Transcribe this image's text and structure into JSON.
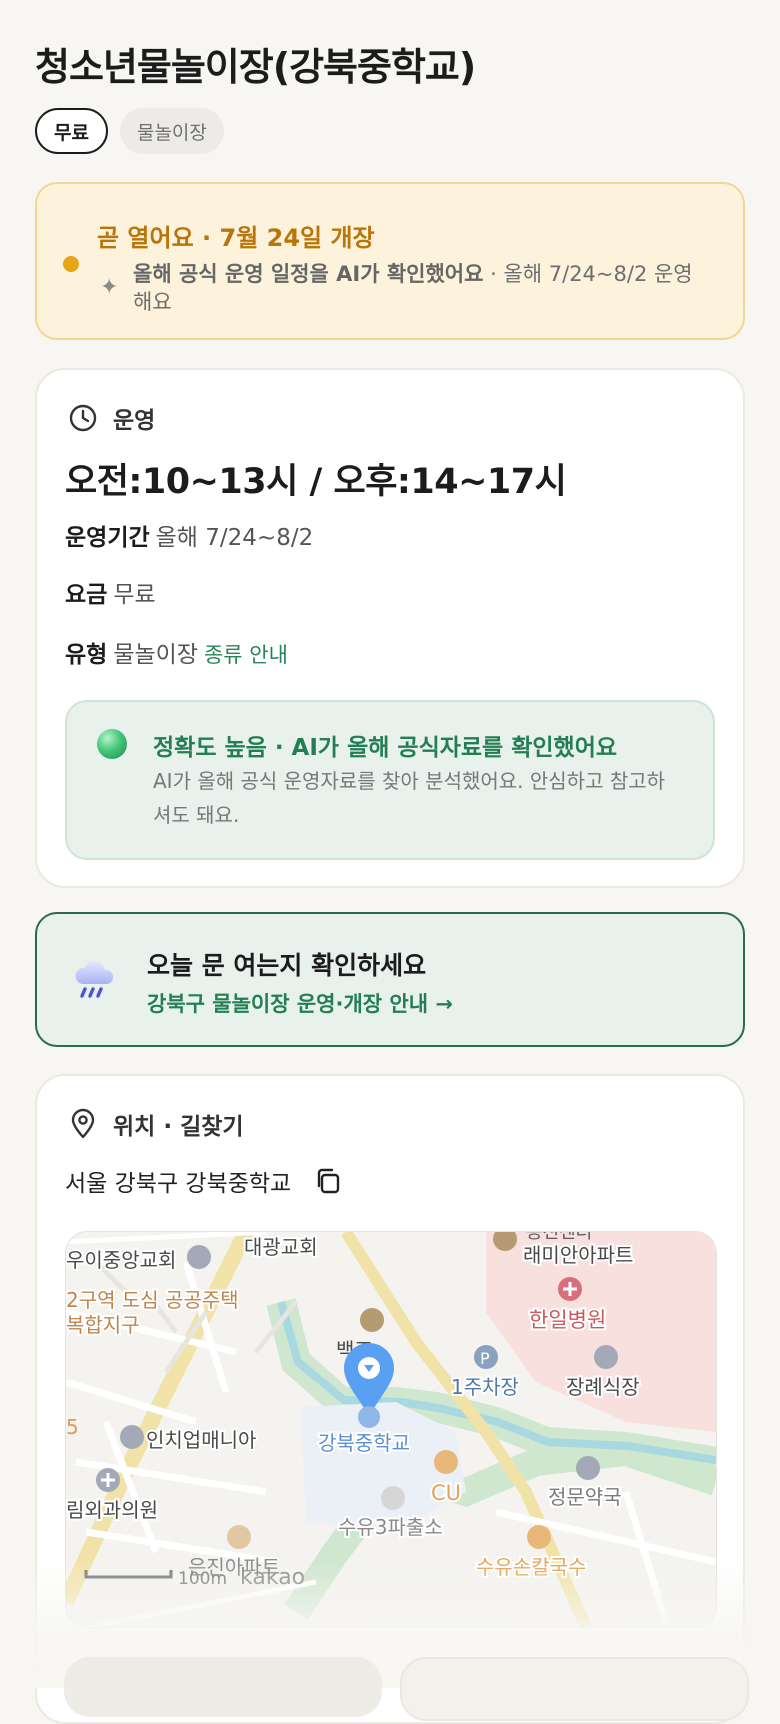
{
  "place": {
    "title": "청소년물놀이장(강북중학교)",
    "chips": {
      "fee": "무료",
      "type": "물놀이장"
    }
  },
  "notice": {
    "headline": "곧 열어요 · 7월 24일 개장",
    "sparkle": "✦",
    "ai_check": "올해 공식 운영 일정을 AI가 확인했어요",
    "detail": " · 올해 7/24~8/2 운영해요",
    "dot_color": "#e9a417"
  },
  "operation": {
    "section_title": "운영",
    "hours": "오전:10~13시 / 오후:14~17시",
    "period_label": "운영기간",
    "period_value": "올해 7/24~8/2",
    "fee_label": "요금",
    "fee_value": "무료",
    "type_label": "유형",
    "type_value": "물놀이장",
    "type_link": "종류 안내",
    "accuracy": {
      "headline": "정확도 높음 · AI가 올해 공식자료를 확인했어요",
      "body": "AI가 올해 공식 운영자료를 찾아 분석했어요. 안심하고 참고하셔도 돼요."
    }
  },
  "banner": {
    "title": "오늘 문 여는지 확인하세요",
    "link": "강북구 물놀이장 운영·개장 안내 →",
    "icon": "rain-cloud-icon"
  },
  "location": {
    "section_title": "위치 · 길찾기",
    "address": "서울 강북구 강북중학교",
    "copy_icon": "copy-icon",
    "map": {
      "labels": {
        "church1": "우이중앙교회",
        "church2": "대광교회",
        "apt1": "래미안아파트",
        "apt1_top": "송천센터",
        "housing1": "2구역 도심 공공주택",
        "housing2": "복합지구",
        "hospital": "한일병원",
        "bus_stop": "백조",
        "parking": "1주차장",
        "funeral": "장례식장",
        "school": "강북중학교",
        "edge_num": "5",
        "interior": "인치업매니아",
        "cu": "CU",
        "clinic": "림외과의원",
        "pharmacy": "정문약국",
        "police": "수유3파출소",
        "noodle": "수유손칼국수",
        "apt2": "은진아파트",
        "scale": "100m",
        "brand": "kakao"
      }
    }
  }
}
